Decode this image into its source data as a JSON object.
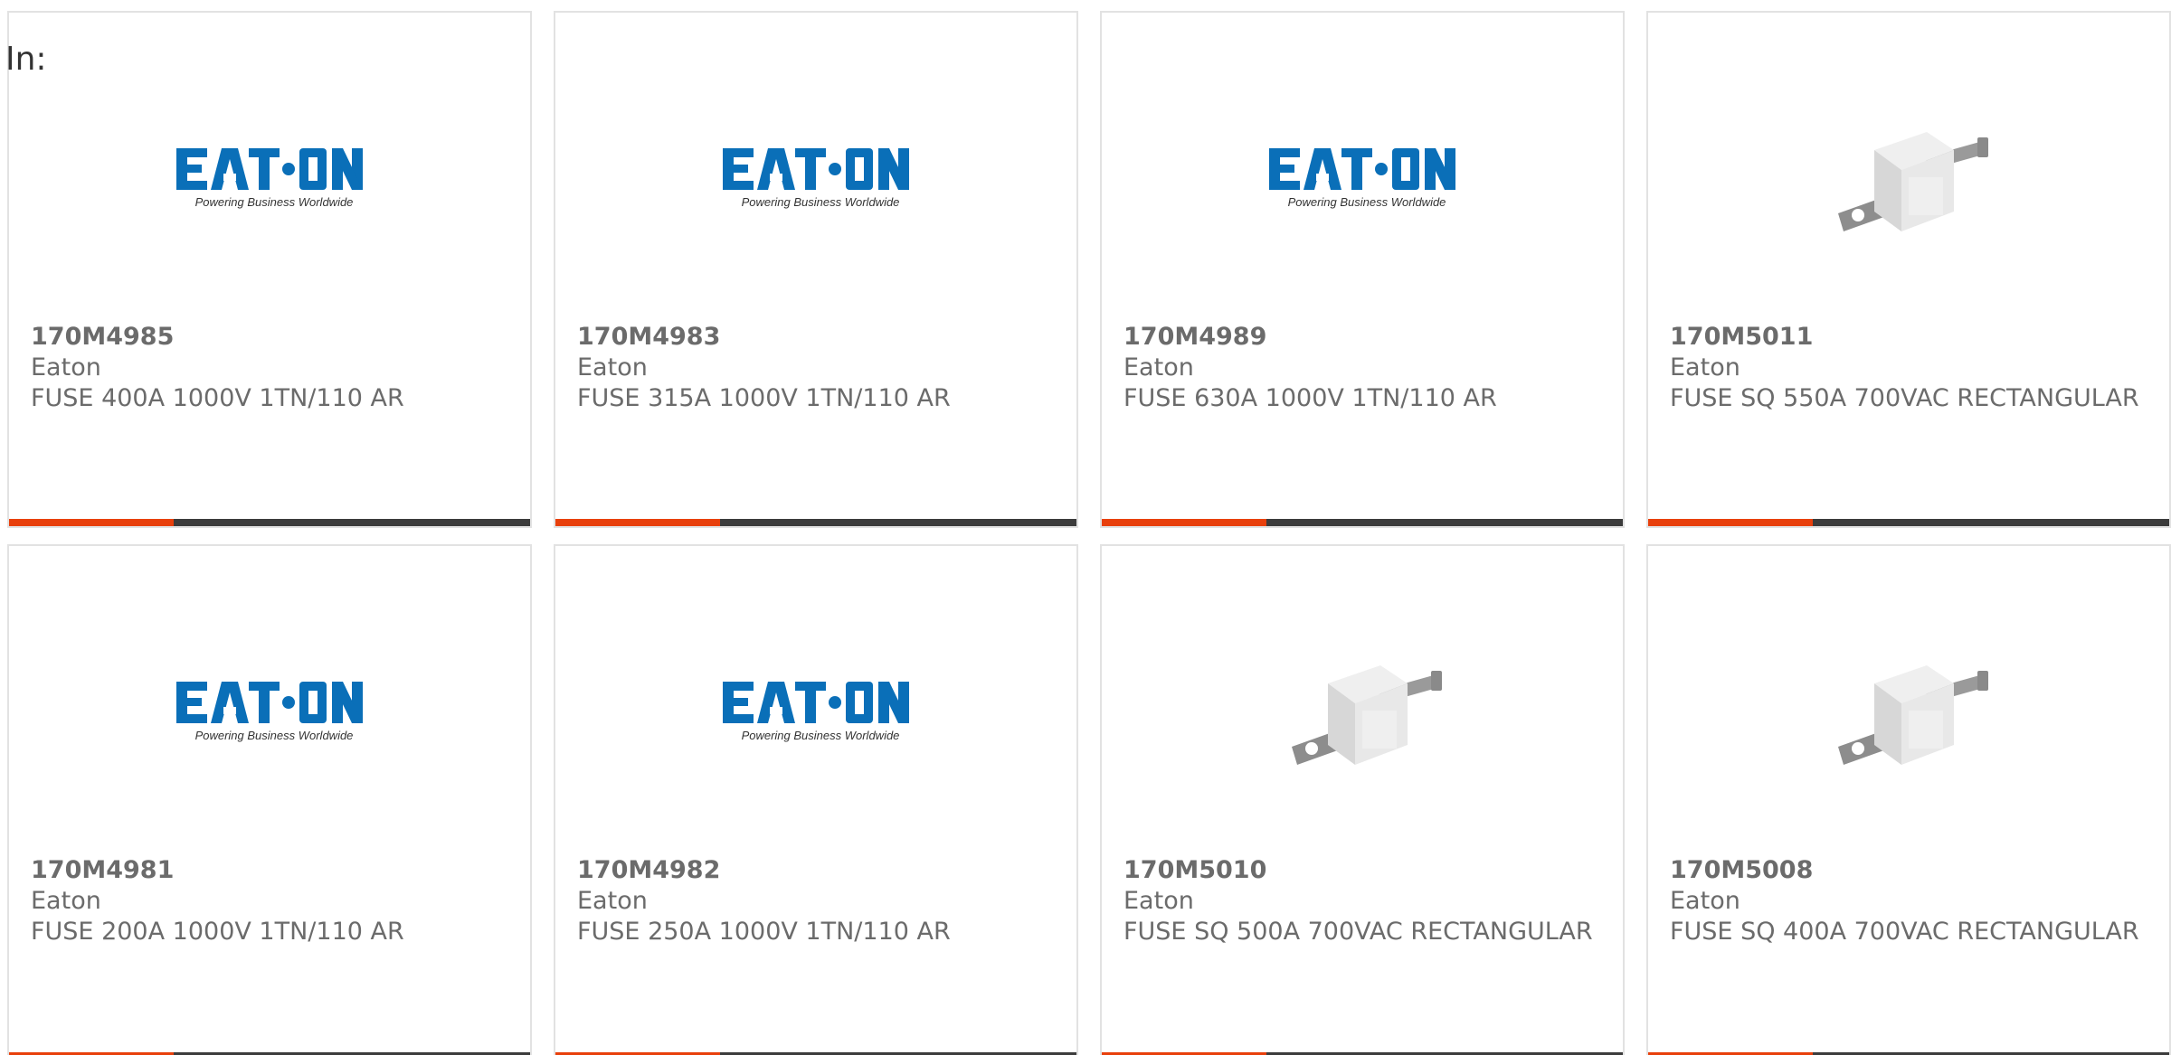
{
  "filter": {
    "label": "In:"
  },
  "products": [
    {
      "part": "170M4985",
      "brand": "Eaton",
      "desc": "FUSE 400A 1000V 1TN/110 AR",
      "image": "eaton-logo"
    },
    {
      "part": "170M4983",
      "brand": "Eaton",
      "desc": "FUSE 315A 1000V 1TN/110 AR",
      "image": "eaton-logo"
    },
    {
      "part": "170M4989",
      "brand": "Eaton",
      "desc": "FUSE 630A 1000V 1TN/110 AR",
      "image": "eaton-logo"
    },
    {
      "part": "170M5011",
      "brand": "Eaton",
      "desc": "FUSE SQ 550A 700VAC RECTANGULAR",
      "image": "fuse-image"
    },
    {
      "part": "170M4981",
      "brand": "Eaton",
      "desc": "FUSE 200A 1000V 1TN/110 AR",
      "image": "eaton-logo"
    },
    {
      "part": "170M4982",
      "brand": "Eaton",
      "desc": "FUSE 250A 1000V 1TN/110 AR",
      "image": "eaton-logo"
    },
    {
      "part": "170M5010",
      "brand": "Eaton",
      "desc": "FUSE SQ 500A 700VAC RECTANGULAR",
      "image": "fuse-image"
    },
    {
      "part": "170M5008",
      "brand": "Eaton",
      "desc": "FUSE SQ 400A 700VAC RECTANGULAR",
      "image": "fuse-image"
    }
  ],
  "logo": {
    "name": "EATON",
    "tagline": "Powering Business Worldwide"
  },
  "colors": {
    "brand_blue": "#0a6fb8",
    "accent_orange": "#e8400c",
    "bar_dark": "#3c3c3c",
    "text_gray": "#6b6b6b",
    "card_border": "#e2e2e2"
  }
}
